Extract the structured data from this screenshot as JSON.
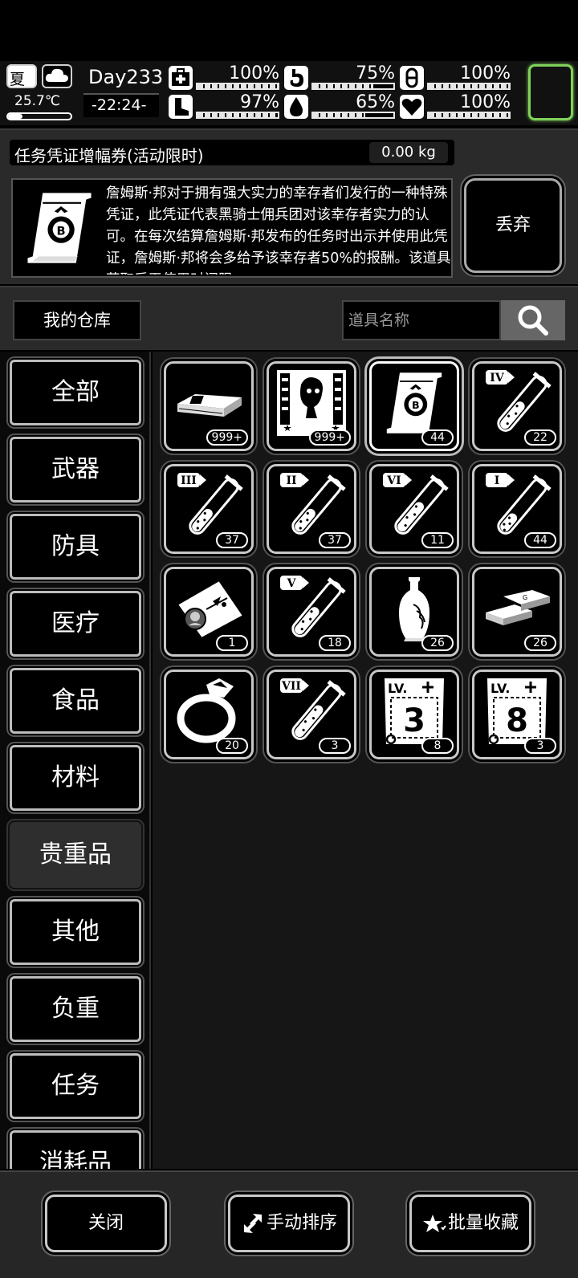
{
  "status": {
    "season": "夏",
    "temperature": "25.7℃",
    "day": "Day233",
    "time": "-22:24-",
    "stats": [
      {
        "name": "health",
        "value": "100%",
        "level": 1.0
      },
      {
        "name": "hunger",
        "value": "75%",
        "level": 0.75
      },
      {
        "name": "medicine",
        "value": "100%",
        "level": 1.0
      },
      {
        "name": "stamina",
        "value": "97%",
        "level": 0.97
      },
      {
        "name": "thirst",
        "value": "65%",
        "level": 0.65
      },
      {
        "name": "mood",
        "value": "100%",
        "level": 1.0
      }
    ]
  },
  "item": {
    "title": "任务凭证增幅券(活动限时)",
    "weight": "0.00 kg",
    "description": "詹姆斯·邦对于拥有强大实力的幸存者们发行的一种特殊凭证，此凭证代表黑骑士佣兵团对该幸存者实力的认可。在每次结算詹姆斯·邦发布的任务时出示并使用此凭证，詹姆斯·邦将会多给予该幸存者50%的报酬。该道具获取后无使用时间限",
    "discard_label": "丢弃"
  },
  "warehouse": {
    "label": "我的仓库",
    "search_placeholder": "道具名称"
  },
  "categories": [
    "全部",
    "武器",
    "防具",
    "医疗",
    "食品",
    "材料",
    "贵重品",
    "其他",
    "负重",
    "任务",
    "消耗品"
  ],
  "active_category": "贵重品",
  "items": [
    {
      "icon": "cash-bundle-icon",
      "qty": "999+"
    },
    {
      "icon": "zombie-poster-icon",
      "qty": "999+"
    },
    {
      "icon": "voucher-scroll-icon",
      "qty": "44",
      "selected": true
    },
    {
      "icon": "potion-iv-icon",
      "qty": "22",
      "tier": "IV",
      "fill": 0.55
    },
    {
      "icon": "potion-iii-icon",
      "qty": "37",
      "tier": "III",
      "fill": 0.45
    },
    {
      "icon": "potion-ii-icon",
      "qty": "37",
      "tier": "II",
      "fill": 0.45
    },
    {
      "icon": "potion-vi-icon",
      "qty": "11",
      "tier": "VI",
      "fill": 0.6
    },
    {
      "icon": "potion-i-icon",
      "qty": "44",
      "tier": "I",
      "fill": 0.35
    },
    {
      "icon": "ticket-icon",
      "qty": "1"
    },
    {
      "icon": "potion-v-icon",
      "qty": "18",
      "tier": "V",
      "fill": 0.55
    },
    {
      "icon": "vase-icon",
      "qty": "26"
    },
    {
      "icon": "gold-bars-icon",
      "qty": "26"
    },
    {
      "icon": "ring-icon",
      "qty": "20"
    },
    {
      "icon": "potion-vii-icon",
      "qty": "3",
      "tier": "VII",
      "fill": 0.65
    },
    {
      "icon": "level-book-3-icon",
      "qty": "8",
      "level": "3"
    },
    {
      "icon": "level-book-8-icon",
      "qty": "3",
      "level": "8"
    }
  ],
  "bottom": {
    "close": "关闭",
    "sort": "手动排序",
    "favorite": "批量收藏"
  }
}
